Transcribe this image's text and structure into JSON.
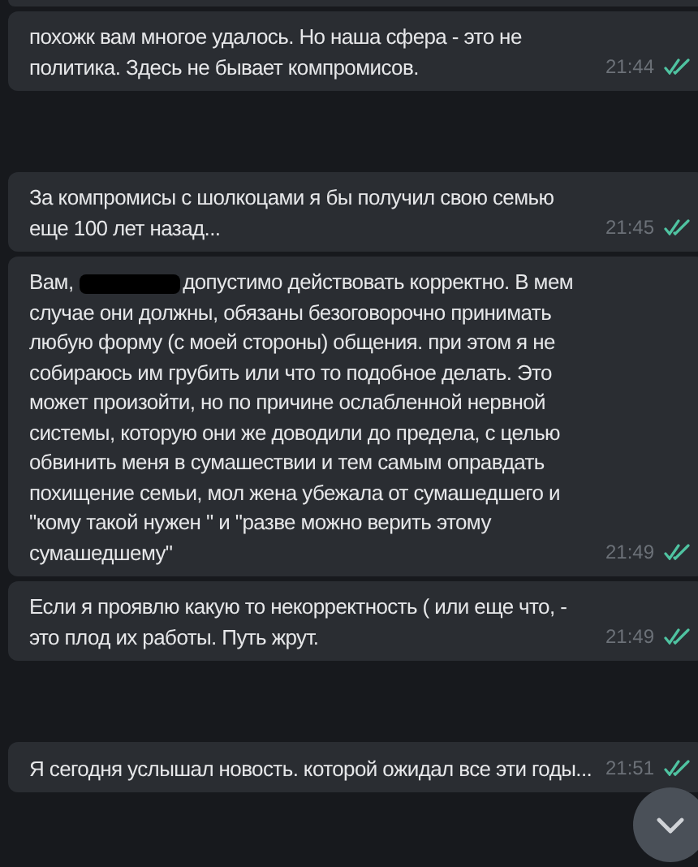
{
  "groups": [
    {
      "messages": [
        {
          "text": "похожк вам многое удалось. Но наша сфера - это не политика. Здесь не бывает компромисов.",
          "time": "21:44",
          "read": true
        }
      ]
    },
    {
      "messages": [
        {
          "text": "За компромисы с шолкоцами я бы получил свою семью еще 100 лет назад...",
          "time": "21:45",
          "read": true
        },
        {
          "lead": "Вам,",
          "redacted": true,
          "text": "допустимо действовать корректно. В мем случае они должны, обязаны безоговорочно принимать любую форму (с моей стороны) общения. при этом я не собираюсь им грубить или что то подобное делать. Это может произойти, но по причине ослабленной нервной системы, которую они же доводили до предела, с целью обвинить меня в сумашествии и тем самым оправдать похищение семьи, мол жена убежала от сумашедшего и \"кому такой нужен \" и \"разве можно верить этому сумашедшему\"",
          "time": "21:49",
          "read": true
        },
        {
          "text": "Если я проявлю какую то некорректность ( или еще что, - это плод их работы. Путь жрут.",
          "time": "21:49",
          "read": true
        }
      ]
    },
    {
      "messages": [
        {
          "text": "Я сегодня услышал новость. которой ожидал все эти годы...",
          "time": "21:51",
          "read": true
        }
      ]
    }
  ]
}
